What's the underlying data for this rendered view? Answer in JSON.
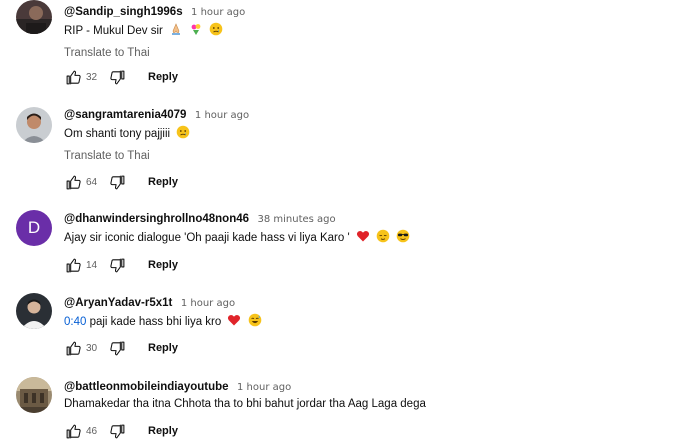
{
  "comments": [
    {
      "author": "@Sandip_singh1996s",
      "time": "1 hour ago",
      "text": "RIP - Mukul Dev sir",
      "translate": "Translate to Thai",
      "likes": "32",
      "reply": "Reply",
      "avatar_icon": "photo-avatar-dark"
    },
    {
      "author": "@sangramtarenia4079",
      "time": "1 hour ago",
      "text": "Om shanti tony pajjiii",
      "translate": "Translate to Thai",
      "likes": "64",
      "reply": "Reply",
      "avatar_icon": "photo-avatar-person"
    },
    {
      "author": "@dhanwindersinghrollno48non46",
      "time": "38 minutes ago",
      "text": "Ajay sir iconic dialogue 'Oh paaji kade hass vi liya Karo '",
      "likes": "14",
      "reply": "Reply",
      "avatar_letter": "D",
      "avatar_color": "#6a2ea8"
    },
    {
      "author": "@AryanYadav-r5x1t",
      "time": "1 hour ago",
      "timestamp_link": "0:40",
      "text": " paji kade hass bhi liya kro",
      "likes": "30",
      "reply": "Reply",
      "avatar_icon": "photo-avatar-person-white"
    },
    {
      "author": "@battleonmobileindiayoutube",
      "time": "1 hour ago",
      "text": "Dhamakedar tha itna Chhota tha to bhi bahut jordar tha Aag Laga dega",
      "likes": "46",
      "reply": "Reply",
      "avatar_icon": "photo-avatar-building"
    }
  ],
  "icons": {
    "like": "thumbs-up-icon",
    "dislike": "thumbs-down-icon"
  },
  "colors": {
    "link": "#065fd4",
    "secondary_text": "#606060",
    "heart": "#e0242a",
    "emoji_face": "#f7c31a"
  }
}
